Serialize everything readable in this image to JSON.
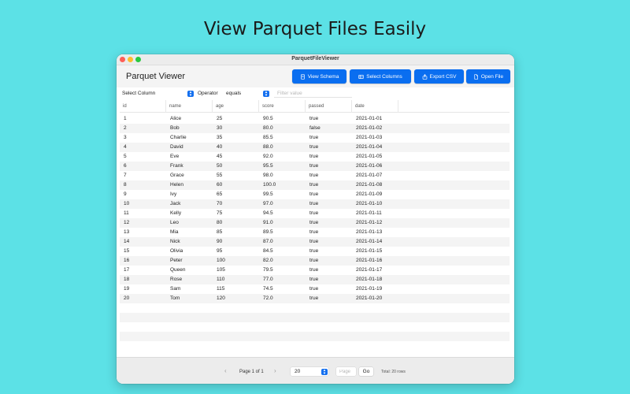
{
  "headline": "View Parquet Files Easily",
  "window": {
    "title": "ParquetFileViewer"
  },
  "toolbar": {
    "app_title": "Parquet Viewer",
    "view_schema_label": "View Schema",
    "select_columns_label": "Select Columns",
    "export_csv_label": "Export CSV",
    "open_file_label": "Open File",
    "button_color": "#0a6ef0"
  },
  "filter": {
    "column_select": "Select Column",
    "operator_label": "Operator",
    "operator_value": "equals",
    "value_placeholder": "Filter value"
  },
  "table": {
    "columns": [
      "id",
      "name",
      "age",
      "score",
      "passed",
      "date"
    ],
    "rows": [
      [
        "1",
        "Alice",
        "25",
        "90.5",
        "true",
        "2021-01-01"
      ],
      [
        "2",
        "Bob",
        "30",
        "80.0",
        "false",
        "2021-01-02"
      ],
      [
        "3",
        "Charlie",
        "35",
        "85.5",
        "true",
        "2021-01-03"
      ],
      [
        "4",
        "David",
        "40",
        "88.0",
        "true",
        "2021-01-04"
      ],
      [
        "5",
        "Eve",
        "45",
        "92.0",
        "true",
        "2021-01-05"
      ],
      [
        "6",
        "Frank",
        "50",
        "95.5",
        "true",
        "2021-01-06"
      ],
      [
        "7",
        "Grace",
        "55",
        "98.0",
        "true",
        "2021-01-07"
      ],
      [
        "8",
        "Helen",
        "60",
        "100.0",
        "true",
        "2021-01-08"
      ],
      [
        "9",
        "Ivy",
        "65",
        "99.5",
        "true",
        "2021-01-09"
      ],
      [
        "10",
        "Jack",
        "70",
        "97.0",
        "true",
        "2021-01-10"
      ],
      [
        "11",
        "Kelly",
        "75",
        "94.5",
        "true",
        "2021-01-11"
      ],
      [
        "12",
        "Leo",
        "80",
        "91.0",
        "true",
        "2021-01-12"
      ],
      [
        "13",
        "Mia",
        "85",
        "89.5",
        "true",
        "2021-01-13"
      ],
      [
        "14",
        "Nick",
        "90",
        "87.0",
        "true",
        "2021-01-14"
      ],
      [
        "15",
        "Olivia",
        "95",
        "84.5",
        "true",
        "2021-01-15"
      ],
      [
        "16",
        "Peter",
        "100",
        "82.0",
        "true",
        "2021-01-16"
      ],
      [
        "17",
        "Queen",
        "105",
        "79.5",
        "true",
        "2021-01-17"
      ],
      [
        "18",
        "Rose",
        "110",
        "77.0",
        "true",
        "2021-01-18"
      ],
      [
        "19",
        "Sam",
        "115",
        "74.5",
        "true",
        "2021-01-19"
      ],
      [
        "20",
        "Tom",
        "120",
        "72.0",
        "true",
        "2021-01-20"
      ]
    ]
  },
  "pagination": {
    "prev_icon": "chevron-left-icon",
    "next_icon": "chevron-right-icon",
    "page_label": "Page 1 of 1",
    "page_size": "20",
    "page_placeholder": "Page",
    "go_label": "Go",
    "total_label": "Total: 20 rows"
  }
}
